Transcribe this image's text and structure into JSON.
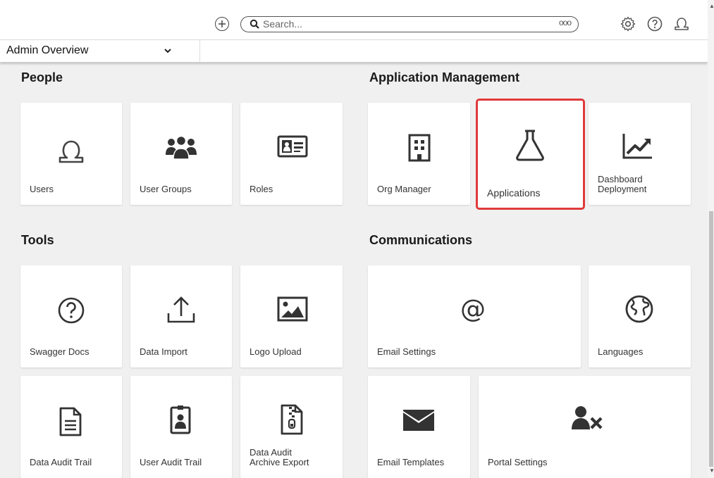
{
  "topbar": {
    "search_placeholder": "Search...",
    "search_more": "ooo"
  },
  "subheader": {
    "selected_view": "Admin Overview"
  },
  "sections": {
    "people": "People",
    "application_management": "Application Management",
    "tools": "Tools",
    "communications": "Communications"
  },
  "tiles": {
    "users": "Users",
    "user_groups": "User Groups",
    "roles": "Roles",
    "org_manager": "Org Manager",
    "applications": "Applications",
    "dashboard_deployment": "Dashboard\nDeployment",
    "swagger_docs": "Swagger Docs",
    "data_import": "Data Import",
    "logo_upload": "Logo Upload",
    "email_settings": "Email Settings",
    "languages": "Languages",
    "data_audit_trail": "Data Audit Trail",
    "user_audit_trail": "User Audit Trail",
    "data_audit_archive_export": "Data Audit\nArchive Export",
    "email_templates": "Email Templates",
    "portal_settings": "Portal Settings"
  },
  "colors": {
    "highlight": "#e03a3a",
    "icon": "#444444"
  }
}
